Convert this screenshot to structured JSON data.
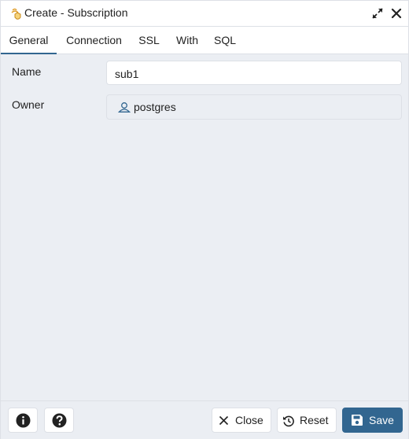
{
  "window": {
    "title": "Create - Subscription"
  },
  "tabs": [
    {
      "label": "General",
      "active": true
    },
    {
      "label": "Connection",
      "active": false
    },
    {
      "label": "SSL",
      "active": false
    },
    {
      "label": "With",
      "active": false
    },
    {
      "label": "SQL",
      "active": false
    }
  ],
  "form": {
    "name_label": "Name",
    "name_value": "sub1",
    "owner_label": "Owner",
    "owner_value": "postgres"
  },
  "footer": {
    "close_label": "Close",
    "reset_label": "Reset",
    "save_label": "Save"
  },
  "colors": {
    "accent": "#326690",
    "panel": "#ebeef3",
    "border": "#dde0e6"
  },
  "icons": {
    "title": "subscription-icon",
    "maximize": "maximize-icon",
    "close": "close-icon",
    "owner": "user-icon",
    "info": "info-icon",
    "help": "help-icon",
    "reset": "reset-icon",
    "save": "save-icon"
  }
}
